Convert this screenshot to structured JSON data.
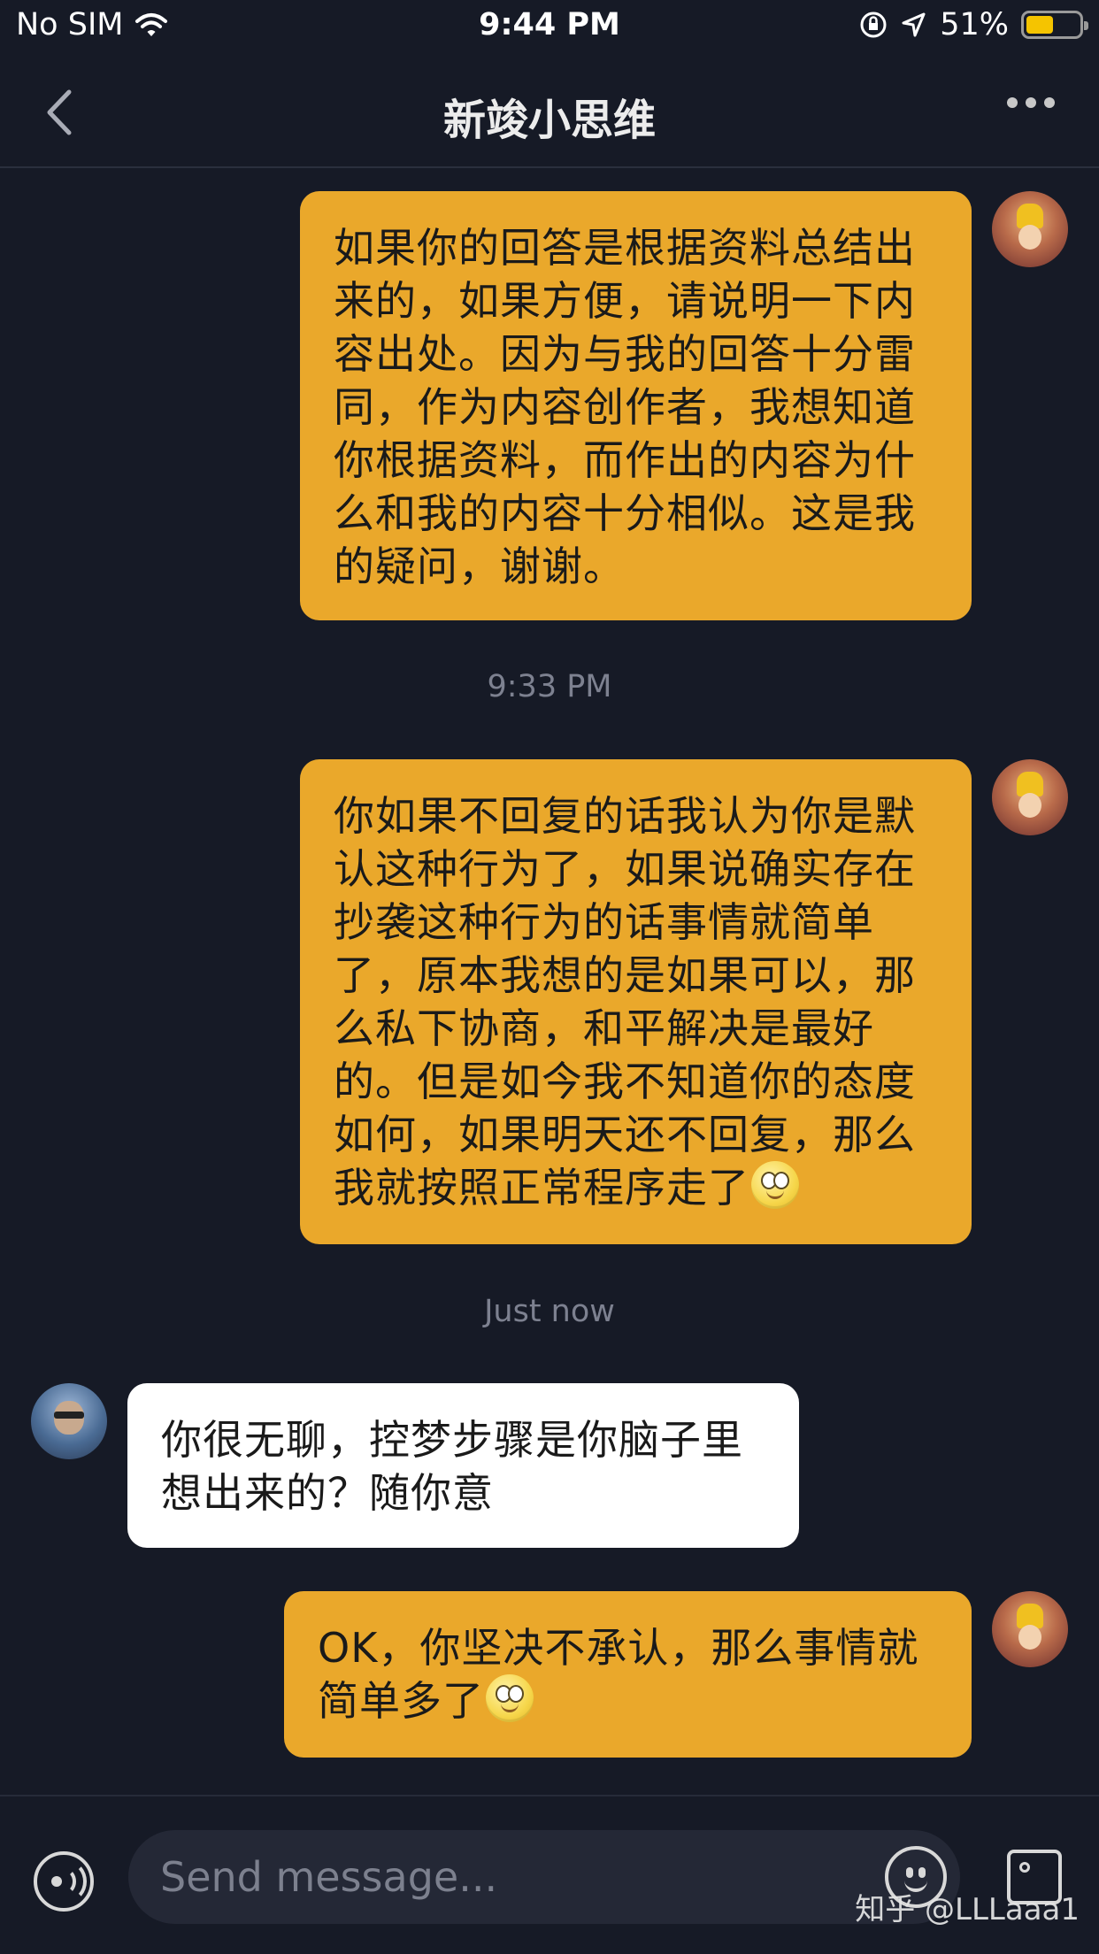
{
  "status_bar": {
    "carrier": "No SIM",
    "time": "9:44 PM",
    "battery_percent": "51%",
    "battery_level": 0.51
  },
  "nav": {
    "title": "新竣小思维"
  },
  "messages": [
    {
      "sender": "me",
      "text": "如果你的回答是根据资料总结出\n来的，如果方便，请说明一下内\n容出处。因为与我的回答十分雷\n同，作为内容创作者，我想知道\n你根据资料，而作出的内容为什\n么和我的内容十分相似。这是我\n的疑问，谢谢。"
    },
    {
      "timestamp": "9:33 PM"
    },
    {
      "sender": "me",
      "text": "你如果不回复的话我认为你是默\n认这种行为了，如果说确实存在\n抄袭这种行为的话事情就简单\n了，原本我想的是如果可以，那\n么私下协商，和平解决是最好\n的。但是如今我不知道你的态度\n如何，如果明天还不回复，那么\n我就按照正常程序走了",
      "emoji": "smiley-emoji"
    },
    {
      "timestamp": "Just now"
    },
    {
      "sender": "other",
      "text": "你很无聊，控梦步骤是你脑子里\n想出来的？随你意"
    },
    {
      "sender": "me",
      "text": "OK，你坚决不承认，那么事情就\n简单多了",
      "emoji": "smiley-emoji"
    }
  ],
  "input": {
    "placeholder": "Send message..."
  },
  "watermark": "知乎 @LLLaaa1",
  "colors": {
    "background": "#161a26",
    "sent_bubble": "#eaa82b",
    "received_bubble": "#ffffff",
    "timestamp": "#7d8190"
  }
}
